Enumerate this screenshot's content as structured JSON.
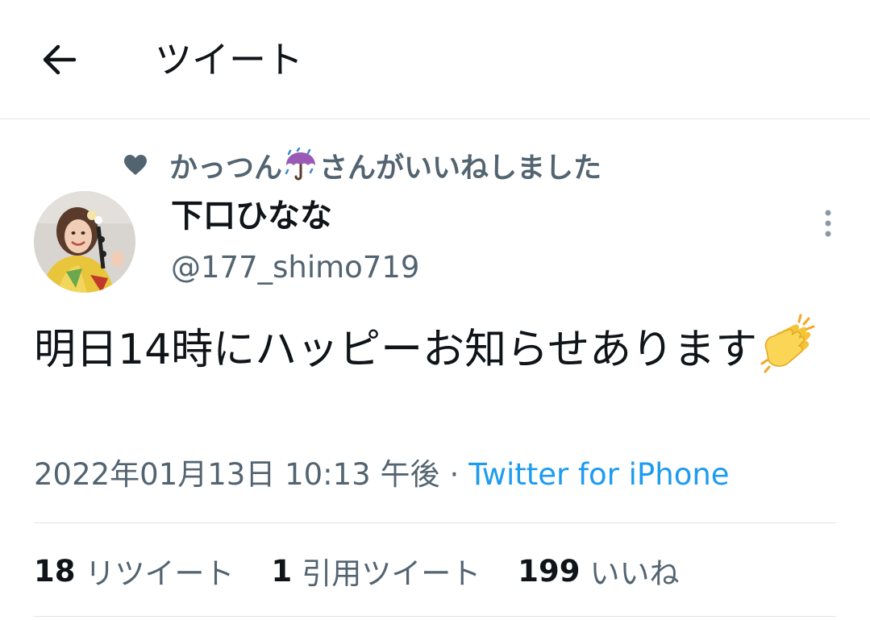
{
  "header": {
    "title": "ツイート",
    "back_icon": "arrow-left-icon"
  },
  "social_context": {
    "icon": "heart-icon",
    "name": "かっつん",
    "name_emoji": "umbrella-with-rain-icon",
    "suffix": "さんがいいねしました"
  },
  "author": {
    "display_name": "下口ひなな",
    "handle": "@177_shimo719",
    "avatar": "profile-photo-avatar"
  },
  "tweet": {
    "text": "明日14時にハッピーお知らせあります",
    "emoji": "clapping-hands-icon"
  },
  "meta": {
    "date": "2022年01月13日",
    "time": "10:13 午後",
    "separator": "·",
    "source": "Twitter for iPhone"
  },
  "stats": [
    {
      "count": "18",
      "label": "リツイート"
    },
    {
      "count": "1",
      "label": "引用ツイート"
    },
    {
      "count": "199",
      "label": "いいね"
    }
  ],
  "colors": {
    "text_primary": "#0f1419",
    "text_secondary": "#536471",
    "accent_blue": "#1d9bf0",
    "divider": "#e1e4e8"
  }
}
